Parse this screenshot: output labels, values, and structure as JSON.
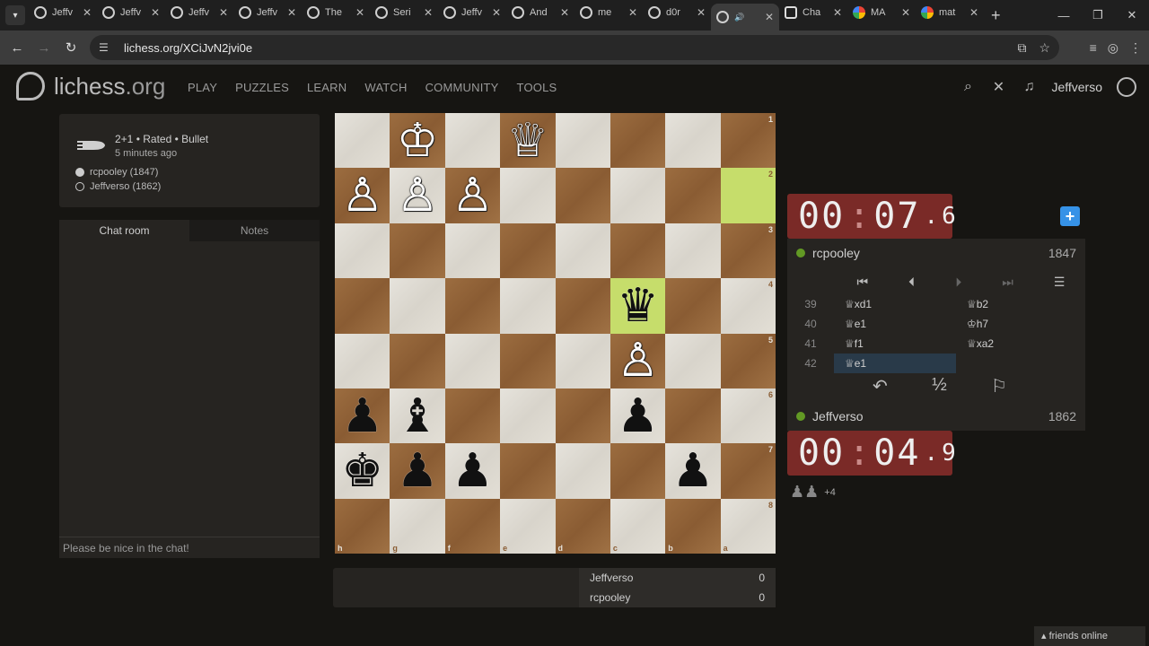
{
  "browser": {
    "tabs": [
      {
        "title": "Jeffv",
        "favicon": "lichess-icon"
      },
      {
        "title": "Jeffv",
        "favicon": "lichess-icon"
      },
      {
        "title": "Jeffv",
        "favicon": "lichess-icon"
      },
      {
        "title": "Jeffv",
        "favicon": "lichess-icon"
      },
      {
        "title": "The",
        "favicon": "lichess-icon"
      },
      {
        "title": "Seri",
        "favicon": "lichess-icon"
      },
      {
        "title": "Jeffv",
        "favicon": "lichess-icon"
      },
      {
        "title": "And",
        "favicon": "lichess-icon"
      },
      {
        "title": "me",
        "favicon": "lichess-icon"
      },
      {
        "title": "d0r",
        "favicon": "lichess-icon"
      },
      {
        "title": "",
        "favicon": "lichess-icon",
        "active": true,
        "audio": true
      },
      {
        "title": "Cha",
        "favicon": "chatgpt-icon"
      },
      {
        "title": "MA",
        "favicon": "google-icon"
      },
      {
        "title": "mat",
        "favicon": "google-icon"
      }
    ],
    "url": "lichess.org/XCiJvN2jvi0e"
  },
  "site": {
    "logo_main": "lichess",
    "logo_tld": ".org",
    "nav": [
      "PLAY",
      "PUZZLES",
      "LEARN",
      "WATCH",
      "COMMUNITY",
      "TOOLS"
    ],
    "username": "Jeffverso"
  },
  "game_info": {
    "line1": "2+1 • Rated • Bullet",
    "line2": "5 minutes ago",
    "white": "rcpooley (1847)",
    "black": "Jeffverso (1862)"
  },
  "chat": {
    "tab_chat": "Chat room",
    "tab_notes": "Notes",
    "placeholder": "Please be nice in the chat!"
  },
  "board": {
    "ranks": [
      "1",
      "2",
      "3",
      "4",
      "5",
      "6",
      "7",
      "8"
    ],
    "files": [
      "h",
      "g",
      "f",
      "e",
      "d",
      "c",
      "b",
      "a"
    ],
    "rows": [
      [
        "",
        "wK",
        "",
        "wQ",
        "",
        "",
        "",
        ""
      ],
      [
        "wP",
        "wP",
        "wP",
        "",
        "",
        "",
        "",
        ""
      ],
      [
        "",
        "",
        "",
        "",
        "",
        "",
        "",
        ""
      ],
      [
        "",
        "",
        "",
        "",
        "",
        "bQ",
        "",
        ""
      ],
      [
        "",
        "",
        "",
        "",
        "",
        "wP",
        "",
        ""
      ],
      [
        "bP",
        "bB",
        "",
        "",
        "",
        "bP",
        "",
        ""
      ],
      [
        "bK",
        "bP",
        "bP",
        "",
        "",
        "",
        "bP",
        ""
      ],
      [
        "",
        "",
        "",
        "",
        "",
        "",
        "",
        ""
      ]
    ],
    "highlights": [
      [
        1,
        7
      ],
      [
        3,
        5
      ]
    ]
  },
  "clocks": {
    "top": {
      "main": "00",
      "sec": "07",
      "tenth": "6"
    },
    "bottom": {
      "main": "00",
      "sec": "04",
      "tenth": "9"
    }
  },
  "players": {
    "top": {
      "name": "rcpooley",
      "rating": "1847"
    },
    "bottom": {
      "name": "Jeffverso",
      "rating": "1862"
    }
  },
  "moves": [
    {
      "num": "39",
      "white": "♕xd1",
      "black": "♕b2"
    },
    {
      "num": "40",
      "white": "♕e1",
      "black": "♔h7"
    },
    {
      "num": "41",
      "white": "♕f1",
      "black": "♕xa2"
    },
    {
      "num": "42",
      "white": "♕e1",
      "black": "",
      "current": true
    }
  ],
  "captured": {
    "pieces": "♟♟",
    "plus": "+4"
  },
  "scores": [
    {
      "name": "Jeffverso",
      "score": "0"
    },
    {
      "name": "rcpooley",
      "score": "0"
    }
  ],
  "friends": "friends online",
  "colors": {
    "clock_bg": "#7a2a27",
    "highlight": "#c6dd6b",
    "accent": "#3692e7",
    "online": "#629924"
  }
}
